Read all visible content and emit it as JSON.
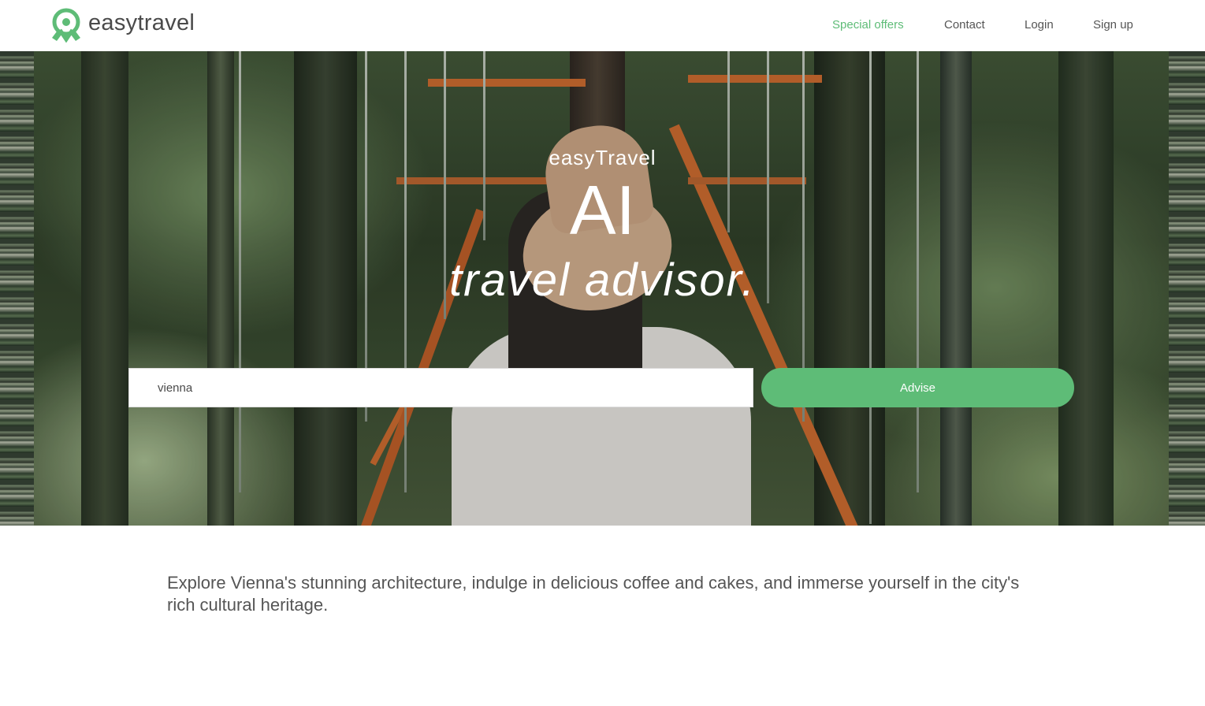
{
  "header": {
    "brand": "easytravel",
    "nav": [
      {
        "label": "Special offers",
        "active": true
      },
      {
        "label": "Contact",
        "active": false
      },
      {
        "label": "Login",
        "active": false
      },
      {
        "label": "Sign up",
        "active": false
      }
    ]
  },
  "hero": {
    "kicker": "easyTravel",
    "title": "AI",
    "subtitle": "travel advisor."
  },
  "search": {
    "value": "vienna",
    "button_label": "Advise"
  },
  "result": {
    "text": "Explore Vienna's stunning architecture, indulge in delicious coffee and cakes, and immerse yourself in the city's rich cultural heritage."
  },
  "colors": {
    "accent": "#5ebc77",
    "text": "#555555"
  },
  "icons": {
    "logo": "map-pin-ribbon-icon"
  }
}
